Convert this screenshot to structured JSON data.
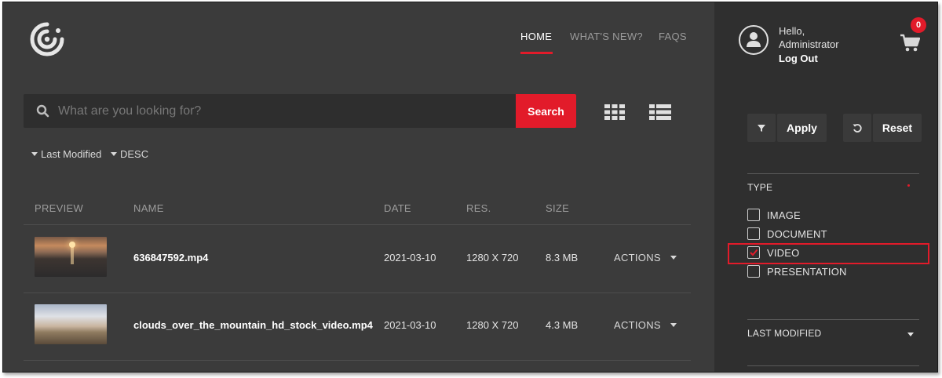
{
  "nav": {
    "home": "HOME",
    "whats_new": "WHAT'S NEW?",
    "faqs": "FAQS"
  },
  "search": {
    "placeholder": "What are you looking for?",
    "button": "Search"
  },
  "sort": {
    "field": "Last Modified",
    "order": "DESC"
  },
  "table": {
    "headers": {
      "preview": "PREVIEW",
      "name": "NAME",
      "date": "DATE",
      "res": "RES.",
      "size": "SIZE"
    },
    "rows": [
      {
        "name": "636847592.mp4",
        "date": "2021-03-10",
        "res": "1280 X 720",
        "size": "8.3 MB",
        "actions": "ACTIONS"
      },
      {
        "name": "clouds_over_the_mountain_hd_stock_video.mp4",
        "date": "2021-03-10",
        "res": "1280 X 720",
        "size": "4.3 MB",
        "actions": "ACTIONS"
      }
    ]
  },
  "user": {
    "hello": "Hello,",
    "name": "Administrator",
    "logout": "Log Out"
  },
  "cart": {
    "count": "0"
  },
  "filters": {
    "apply": "Apply",
    "reset": "Reset",
    "type_heading": "TYPE",
    "types": [
      {
        "label": "IMAGE",
        "checked": false
      },
      {
        "label": "DOCUMENT",
        "checked": false
      },
      {
        "label": "VIDEO",
        "checked": true
      },
      {
        "label": "PRESENTATION",
        "checked": false
      }
    ],
    "last_modified_heading": "LAST MODIFIED"
  },
  "colors": {
    "accent": "#e21b2a",
    "background": "#3b3b3b",
    "sidebar": "#2f2f2f"
  },
  "icons": [
    "logo-icon",
    "search-icon",
    "grid-view-icon",
    "list-view-icon",
    "user-icon",
    "cart-icon",
    "filter-icon",
    "reset-icon",
    "checkmark-icon"
  ]
}
